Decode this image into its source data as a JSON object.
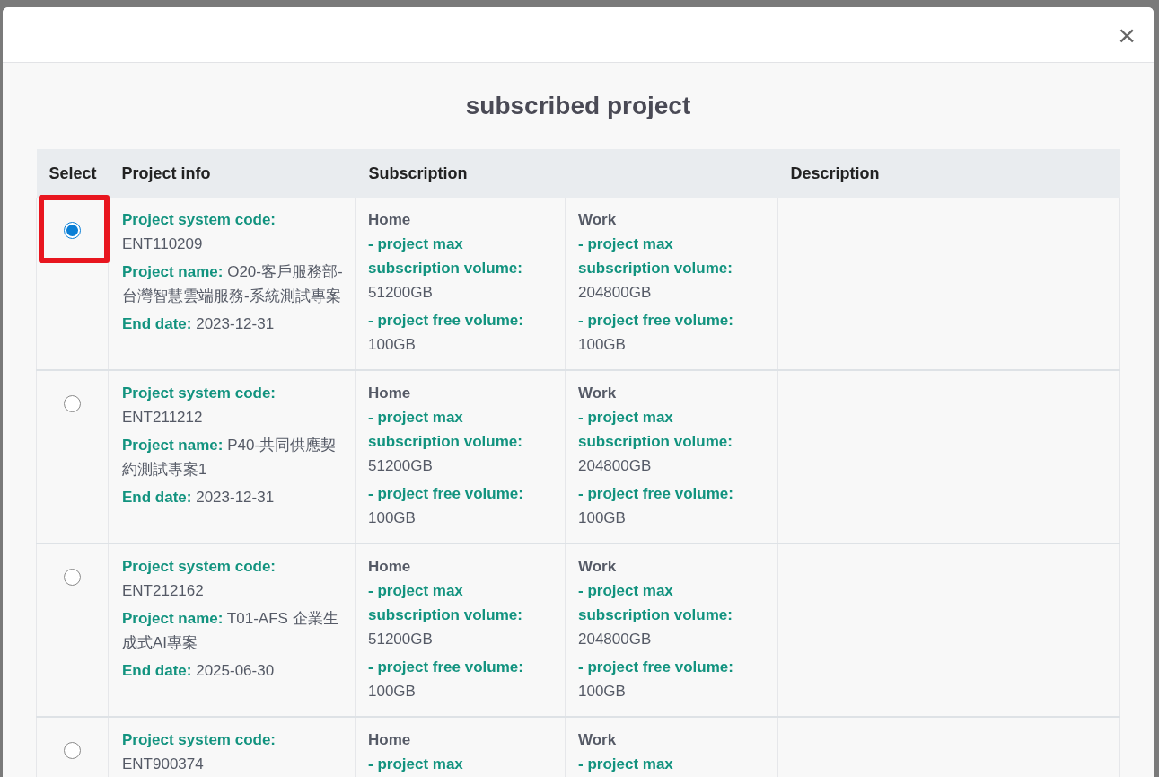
{
  "dialog": {
    "title": "subscribed project",
    "close": "×"
  },
  "table": {
    "columns": [
      {
        "kind": "select",
        "label": "Select"
      },
      {
        "kind": "info",
        "label": "Project info"
      },
      {
        "kind": "subscription",
        "label": "Subscription"
      },
      {
        "kind": "description",
        "label": "Description"
      }
    ],
    "rows": [
      {
        "selected": true,
        "highlighted": true,
        "info": [
          {
            "label": "Project system code:",
            "value": "ENT110209"
          },
          {
            "label": "Project name:",
            "value": "O20-客戶服務部-台灣智慧雲端服務-系統測試專案"
          },
          {
            "label": "End date:",
            "value": "2023-12-31"
          }
        ],
        "subscriptions": [
          {
            "title": "Home",
            "lines": [
              {
                "label": "- project max subscription volume:",
                "value": "51200GB"
              },
              {
                "label": "- project free volume:",
                "value": "100GB"
              }
            ]
          },
          {
            "title": "Work",
            "lines": [
              {
                "label": "- project max subscription volume:",
                "value": "204800GB"
              },
              {
                "label": "- project free volume:",
                "value": "100GB"
              }
            ]
          }
        ]
      },
      {
        "selected": false,
        "highlighted": false,
        "info": [
          {
            "label": "Project system code:",
            "value": "ENT211212"
          },
          {
            "label": "Project name:",
            "value": "P40-共同供應契約測試專案1"
          },
          {
            "label": "End date:",
            "value": "2023-12-31"
          }
        ],
        "subscriptions": [
          {
            "title": "Home",
            "lines": [
              {
                "label": "- project max subscription volume:",
                "value": "51200GB"
              },
              {
                "label": "- project free volume:",
                "value": "100GB"
              }
            ]
          },
          {
            "title": "Work",
            "lines": [
              {
                "label": "- project max subscription volume:",
                "value": "204800GB"
              },
              {
                "label": "- project free volume:",
                "value": "100GB"
              }
            ]
          }
        ]
      },
      {
        "selected": false,
        "highlighted": false,
        "info": [
          {
            "label": "Project system code:",
            "value": "ENT212162"
          },
          {
            "label": "Project name:",
            "value": "T01-AFS 企業生成式AI專案"
          },
          {
            "label": "End date:",
            "value": "2025-06-30"
          }
        ],
        "subscriptions": [
          {
            "title": "Home",
            "lines": [
              {
                "label": "- project max subscription volume:",
                "value": "51200GB"
              },
              {
                "label": "- project free volume:",
                "value": "100GB"
              }
            ]
          },
          {
            "title": "Work",
            "lines": [
              {
                "label": "- project max subscription volume:",
                "value": "204800GB"
              },
              {
                "label": "- project free volume:",
                "value": "100GB"
              }
            ]
          }
        ]
      },
      {
        "selected": false,
        "highlighted": false,
        "info": [
          {
            "label": "Project system code:",
            "value": "ENT900374"
          }
        ],
        "subscriptions": [
          {
            "title": "Home",
            "lines": [
              {
                "label": "- project max"
              }
            ]
          },
          {
            "title": "Work",
            "lines": [
              {
                "label": "- project max"
              }
            ]
          }
        ]
      }
    ]
  }
}
